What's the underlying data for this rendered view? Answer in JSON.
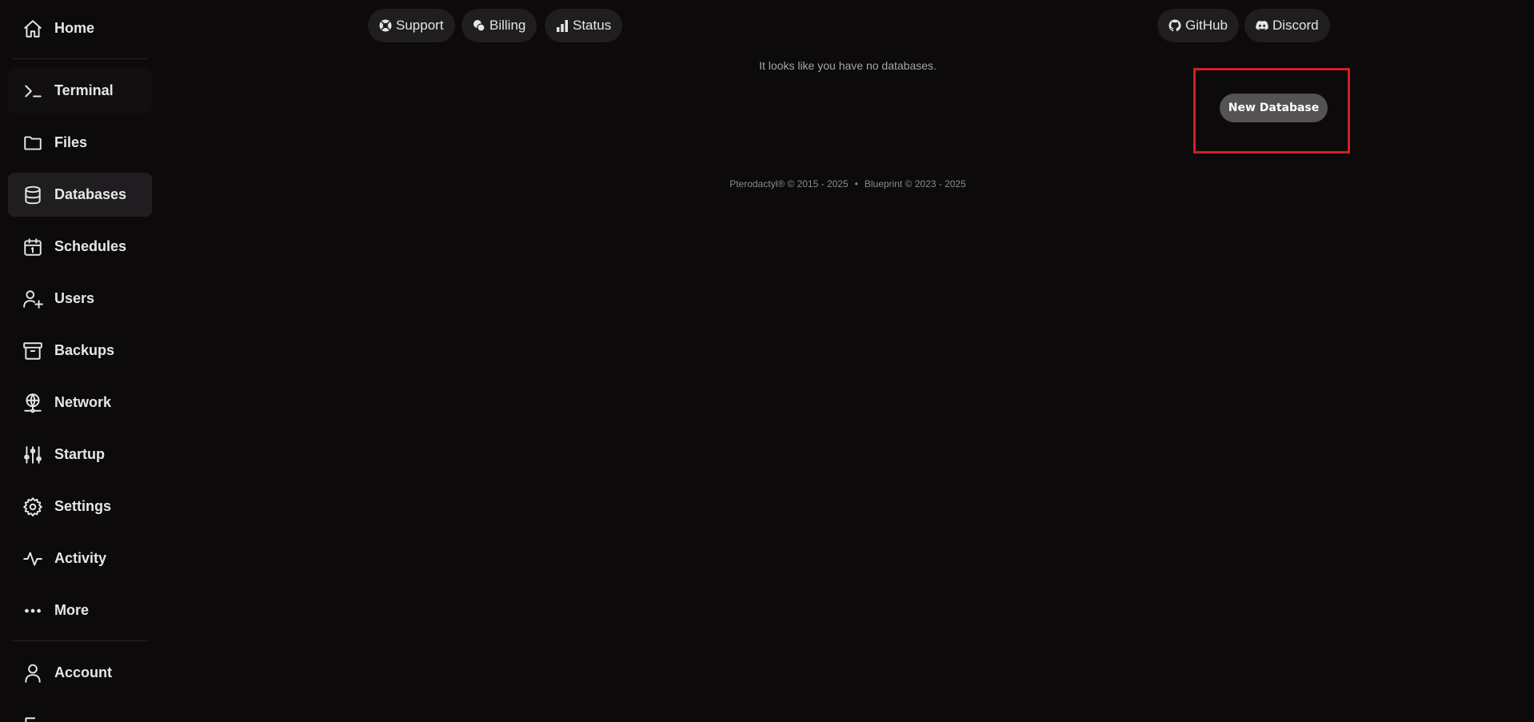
{
  "sidebar": {
    "items": [
      {
        "label": "Home",
        "icon": "home-icon"
      },
      {
        "label": "Terminal",
        "icon": "terminal-icon"
      },
      {
        "label": "Files",
        "icon": "folder-icon"
      },
      {
        "label": "Databases",
        "icon": "database-icon"
      },
      {
        "label": "Schedules",
        "icon": "calendar-icon"
      },
      {
        "label": "Users",
        "icon": "user-plus-icon"
      },
      {
        "label": "Backups",
        "icon": "archive-icon"
      },
      {
        "label": "Network",
        "icon": "globe-network-icon"
      },
      {
        "label": "Startup",
        "icon": "sliders-icon"
      },
      {
        "label": "Settings",
        "icon": "gear-icon"
      },
      {
        "label": "Activity",
        "icon": "activity-icon"
      },
      {
        "label": "More",
        "icon": "dots-icon"
      },
      {
        "label": "Account",
        "icon": "user-icon"
      }
    ],
    "active": "Databases"
  },
  "topnav": {
    "support": "Support",
    "billing": "Billing",
    "status": "Status",
    "github": "GitHub",
    "discord": "Discord"
  },
  "main": {
    "empty_message": "It looks like you have no databases.",
    "new_database_label": "New Database"
  },
  "footer": {
    "pterodactyl": "Pterodactyl® © 2015 - 2025",
    "separator": "•",
    "blueprint": "Blueprint © 2023 - 2025"
  },
  "colors": {
    "background": "#0c0a0b",
    "active_item": "#1f1d1f",
    "button": "#545254",
    "highlight": "#d41e25"
  }
}
